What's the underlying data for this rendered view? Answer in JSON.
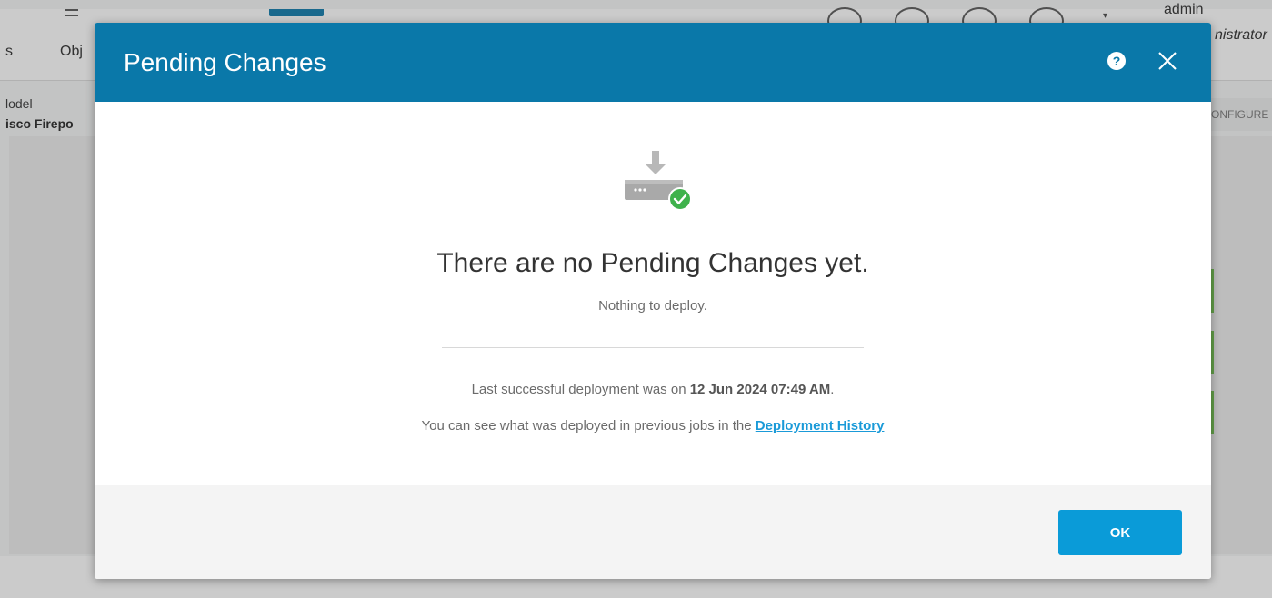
{
  "background": {
    "nav_partial_left": "s",
    "nav_partial_objects": "Obj",
    "user_name": "admin",
    "user_role_partial": "nistrator",
    "model_label_partial": "lodel",
    "model_value_partial": "isco Firepo",
    "configure_partial": "ONFIGURE"
  },
  "modal": {
    "title": "Pending Changes",
    "help_icon": "question-circle-icon",
    "help_glyph": "?",
    "close_icon": "close-x-icon",
    "illustration_icon": "deploy-device-check-icon",
    "empty_title": "There are no Pending Changes yet.",
    "empty_subtitle": "Nothing to deploy.",
    "last_deploy_prefix": "Last successful deployment was on ",
    "last_deploy_date": "12 Jun 2024 07:49 AM",
    "last_deploy_suffix": ".",
    "history_prefix": "You can see what was deployed in previous jobs in the ",
    "history_link": "Deployment History",
    "ok_label": "OK"
  },
  "colors": {
    "header": "#0a78a9",
    "ok_button": "#0a9bd8",
    "link": "#1a9ad8",
    "success": "#3fb24c"
  }
}
